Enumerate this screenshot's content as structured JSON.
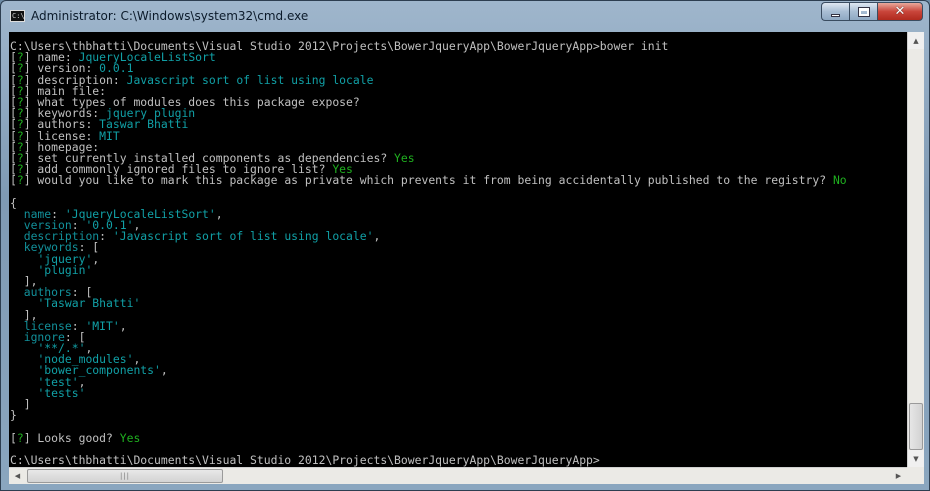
{
  "window": {
    "title": "Administrator: C:\\Windows\\system32\\cmd.exe",
    "icon": "cmd-icon",
    "controls": {
      "minimize": "minimize-icon",
      "maximize": "maximize-icon",
      "close": "close-icon",
      "close_glyph": "✕"
    }
  },
  "colors": {
    "console_bg": "#000000",
    "text": "#c0c0c0",
    "cyan": "#11a0a6",
    "green": "#1fb01f",
    "titlebar": "#8aa6bf",
    "close_button": "#c9453a"
  },
  "console": {
    "lines": [
      [
        {
          "t": "C:\\Users\\thbhatti\\Documents\\Visual Studio 2012\\Projects\\BowerJqueryApp\\BowerJqueryApp>bower init",
          "c": "g"
        }
      ],
      [
        {
          "t": "[",
          "c": "g"
        },
        {
          "t": "?",
          "c": "grn"
        },
        {
          "t": "] name: ",
          "c": "g"
        },
        {
          "t": "JqueryLocaleListSort",
          "c": "c"
        }
      ],
      [
        {
          "t": "[",
          "c": "g"
        },
        {
          "t": "?",
          "c": "grn"
        },
        {
          "t": "] version: ",
          "c": "g"
        },
        {
          "t": "0.0.1",
          "c": "c"
        }
      ],
      [
        {
          "t": "[",
          "c": "g"
        },
        {
          "t": "?",
          "c": "grn"
        },
        {
          "t": "] description: ",
          "c": "g"
        },
        {
          "t": "Javascript sort of list using locale",
          "c": "c"
        }
      ],
      [
        {
          "t": "[",
          "c": "g"
        },
        {
          "t": "?",
          "c": "grn"
        },
        {
          "t": "] main file:",
          "c": "g"
        }
      ],
      [
        {
          "t": "[",
          "c": "g"
        },
        {
          "t": "?",
          "c": "grn"
        },
        {
          "t": "] what types of modules does this package expose?",
          "c": "g"
        }
      ],
      [
        {
          "t": "[",
          "c": "g"
        },
        {
          "t": "?",
          "c": "grn"
        },
        {
          "t": "] keywords: ",
          "c": "g"
        },
        {
          "t": "jquery plugin",
          "c": "c"
        }
      ],
      [
        {
          "t": "[",
          "c": "g"
        },
        {
          "t": "?",
          "c": "grn"
        },
        {
          "t": "] authors: ",
          "c": "g"
        },
        {
          "t": "Taswar Bhatti",
          "c": "c"
        }
      ],
      [
        {
          "t": "[",
          "c": "g"
        },
        {
          "t": "?",
          "c": "grn"
        },
        {
          "t": "] license: ",
          "c": "g"
        },
        {
          "t": "MIT",
          "c": "c"
        }
      ],
      [
        {
          "t": "[",
          "c": "g"
        },
        {
          "t": "?",
          "c": "grn"
        },
        {
          "t": "] homepage:",
          "c": "g"
        }
      ],
      [
        {
          "t": "[",
          "c": "g"
        },
        {
          "t": "?",
          "c": "grn"
        },
        {
          "t": "] set currently installed components as dependencies? ",
          "c": "g"
        },
        {
          "t": "Yes",
          "c": "grn"
        }
      ],
      [
        {
          "t": "[",
          "c": "g"
        },
        {
          "t": "?",
          "c": "grn"
        },
        {
          "t": "] add commonly ignored files to ignore list? ",
          "c": "g"
        },
        {
          "t": "Yes",
          "c": "grn"
        }
      ],
      [
        {
          "t": "[",
          "c": "g"
        },
        {
          "t": "?",
          "c": "grn"
        },
        {
          "t": "] would you like to mark this package as private which prevents it from being accidentally published to the registry? ",
          "c": "g"
        },
        {
          "t": "No",
          "c": "grn"
        }
      ],
      [
        {
          "t": "",
          "c": "g"
        }
      ],
      [
        {
          "t": "{",
          "c": "g"
        }
      ],
      [
        {
          "t": "  ",
          "c": "g"
        },
        {
          "t": "name",
          "c": "k"
        },
        {
          "t": ": ",
          "c": "g"
        },
        {
          "t": "'JqueryLocaleListSort'",
          "c": "c"
        },
        {
          "t": ",",
          "c": "g"
        }
      ],
      [
        {
          "t": "  ",
          "c": "g"
        },
        {
          "t": "version",
          "c": "k"
        },
        {
          "t": ": ",
          "c": "g"
        },
        {
          "t": "'0.0.1'",
          "c": "c"
        },
        {
          "t": ",",
          "c": "g"
        }
      ],
      [
        {
          "t": "  ",
          "c": "g"
        },
        {
          "t": "description",
          "c": "k"
        },
        {
          "t": ": ",
          "c": "g"
        },
        {
          "t": "'Javascript sort of list using locale'",
          "c": "c"
        },
        {
          "t": ",",
          "c": "g"
        }
      ],
      [
        {
          "t": "  ",
          "c": "g"
        },
        {
          "t": "keywords",
          "c": "k"
        },
        {
          "t": ": [",
          "c": "g"
        }
      ],
      [
        {
          "t": "    ",
          "c": "g"
        },
        {
          "t": "'jquery'",
          "c": "c"
        },
        {
          "t": ",",
          "c": "g"
        }
      ],
      [
        {
          "t": "    ",
          "c": "g"
        },
        {
          "t": "'plugin'",
          "c": "c"
        }
      ],
      [
        {
          "t": "  ],",
          "c": "g"
        }
      ],
      [
        {
          "t": "  ",
          "c": "g"
        },
        {
          "t": "authors",
          "c": "k"
        },
        {
          "t": ": [",
          "c": "g"
        }
      ],
      [
        {
          "t": "    ",
          "c": "g"
        },
        {
          "t": "'Taswar Bhatti'",
          "c": "c"
        }
      ],
      [
        {
          "t": "  ],",
          "c": "g"
        }
      ],
      [
        {
          "t": "  ",
          "c": "g"
        },
        {
          "t": "license",
          "c": "k"
        },
        {
          "t": ": ",
          "c": "g"
        },
        {
          "t": "'MIT'",
          "c": "c"
        },
        {
          "t": ",",
          "c": "g"
        }
      ],
      [
        {
          "t": "  ",
          "c": "g"
        },
        {
          "t": "ignore",
          "c": "k"
        },
        {
          "t": ": [",
          "c": "g"
        }
      ],
      [
        {
          "t": "    ",
          "c": "g"
        },
        {
          "t": "'**/.*'",
          "c": "c"
        },
        {
          "t": ",",
          "c": "g"
        }
      ],
      [
        {
          "t": "    ",
          "c": "g"
        },
        {
          "t": "'node_modules'",
          "c": "c"
        },
        {
          "t": ",",
          "c": "g"
        }
      ],
      [
        {
          "t": "    ",
          "c": "g"
        },
        {
          "t": "'bower_components'",
          "c": "c"
        },
        {
          "t": ",",
          "c": "g"
        }
      ],
      [
        {
          "t": "    ",
          "c": "g"
        },
        {
          "t": "'test'",
          "c": "c"
        },
        {
          "t": ",",
          "c": "g"
        }
      ],
      [
        {
          "t": "    ",
          "c": "g"
        },
        {
          "t": "'tests'",
          "c": "c"
        }
      ],
      [
        {
          "t": "  ]",
          "c": "g"
        }
      ],
      [
        {
          "t": "}",
          "c": "g"
        }
      ],
      [
        {
          "t": "",
          "c": "g"
        }
      ],
      [
        {
          "t": "[",
          "c": "g"
        },
        {
          "t": "?",
          "c": "grn"
        },
        {
          "t": "] Looks good? ",
          "c": "g"
        },
        {
          "t": "Yes",
          "c": "grn"
        }
      ],
      [
        {
          "t": "",
          "c": "g"
        }
      ],
      [
        {
          "t": "C:\\Users\\thbhatti\\Documents\\Visual Studio 2012\\Projects\\BowerJqueryApp\\BowerJqueryApp>",
          "c": "g"
        }
      ]
    ]
  },
  "scrollbars": {
    "vertical_position": 0.93,
    "horizontal_position": 0.0,
    "up_arrow": "▲",
    "down_arrow": "▼",
    "left_arrow": "◀",
    "right_arrow": "▶",
    "grip": "|||"
  }
}
